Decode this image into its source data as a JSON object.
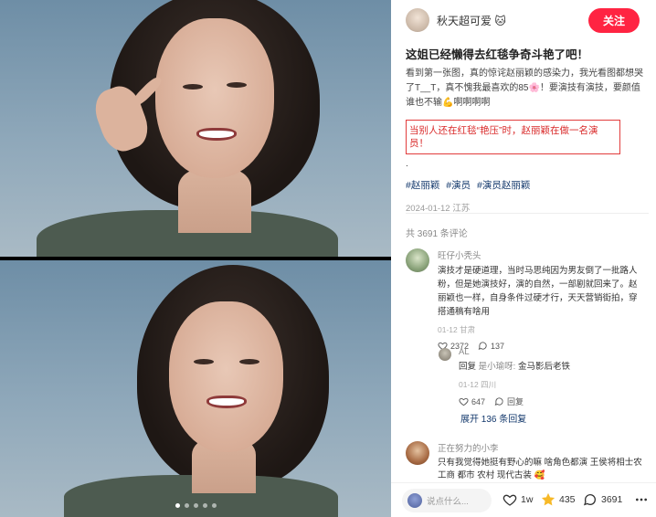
{
  "author": {
    "name": "秋天超可爱 🐱",
    "follow_label": "关注"
  },
  "post": {
    "title": "这姐已经懒得去红毯争奇斗艳了吧！",
    "description": "看到第一张图，真的惊诧赵丽颖的感染力，我光看图都想哭了T__T，真不愧我最喜欢的85🌸！要演技有演技，要颜值谁也不输💪啊啊啊啊",
    "highlight": "当别人还在红毯“艳压”时，赵丽颖在做一名演员！",
    "dot_line": ".",
    "tags": [
      "#赵丽颖",
      "#演员",
      "#演员赵丽颖"
    ],
    "date_location": "2024-01-12 江苏"
  },
  "comments_header": "共 3691 条评论",
  "comments": [
    {
      "user": "旺仔小秃头",
      "text": "演技才是硬道理，当时马思纯因为男友倒了一批路人粉，但是她演技好，演的自然，一部剧就回来了。赵丽颖也一样，自身条件过硬才行，天天营销街拍，穿搭通稿有啥用",
      "meta": "01-12 甘肃",
      "likes": "2372",
      "replies": "137"
    },
    {
      "user": "AL",
      "reply_prefix": "回复",
      "reply_to": "是小瑜呀:",
      "text": "金马影后老铁",
      "meta": "01-12 四川",
      "likes": "647",
      "reply_label": "回复"
    },
    {
      "user": "正在努力的小李",
      "text": "只有我觉得她挺有野心的嘛 啥角色都演 王侯将相士农工商 都市 农村 现代古装 🥰"
    }
  ],
  "expand_label": "展开 136 条回复",
  "bottom_bar": {
    "say_placeholder": "说点什么...",
    "likes": "1w",
    "stars": "435",
    "comments": "3691"
  },
  "gallery": {
    "dot_count": 5,
    "active_dot": 1
  },
  "colors": {
    "accent_red": "#ff2442",
    "tag_blue": "#13386c",
    "highlight_red": "#e23c3c"
  },
  "icons": [
    "heart-icon",
    "comment-icon",
    "star-icon",
    "ellipsis-icon"
  ]
}
